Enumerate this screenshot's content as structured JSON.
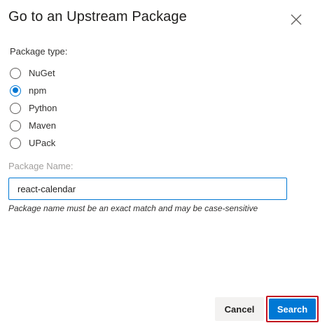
{
  "dialog": {
    "title": "Go to an Upstream Package",
    "close_icon": "close-icon"
  },
  "package_type": {
    "label": "Package type:",
    "options": [
      {
        "label": "NuGet",
        "selected": false
      },
      {
        "label": "npm",
        "selected": true
      },
      {
        "label": "Python",
        "selected": false
      },
      {
        "label": "Maven",
        "selected": false
      },
      {
        "label": "UPack",
        "selected": false
      }
    ]
  },
  "package_name": {
    "label": "Package Name:",
    "value": "react-calendar",
    "hint": "Package name must be an exact match and may be case-sensitive"
  },
  "actions": {
    "cancel_label": "Cancel",
    "search_label": "Search"
  },
  "colors": {
    "accent": "#0078d4",
    "highlight_border": "#c50f1f"
  }
}
